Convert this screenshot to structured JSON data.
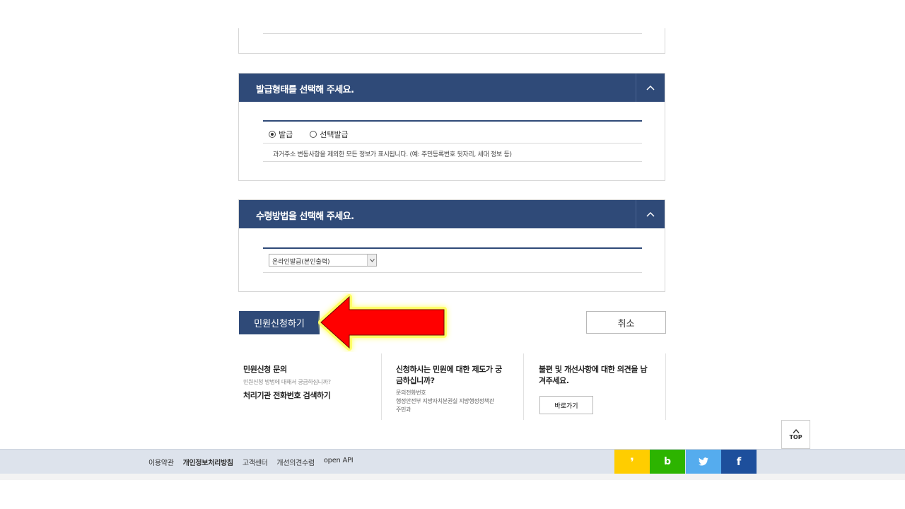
{
  "issue_form": {
    "title": "발급형태를 선택해 주세요.",
    "options": [
      {
        "label": "발급",
        "selected": true
      },
      {
        "label": "선택발급",
        "selected": false
      }
    ],
    "note": "과거주소 변동사항을 제외한 모든 정보가 표시됩니다. (예: 주민등록번호 뒷자리, 세대 정보 등)"
  },
  "receive_method": {
    "title": "수령방법을 선택해 주세요.",
    "selected": "온라인발급(본인출력)"
  },
  "actions": {
    "submit_label": "민원신청하기",
    "cancel_label": "취소"
  },
  "annotation": {
    "arrow_color": "#ff0000",
    "glow_color": "#ffff66"
  },
  "info": {
    "col1": {
      "title": "민원신청 문의",
      "sub": "민원신청 방법에 대해서 궁금하십니까?",
      "link": "처리기관 전화번호 검색하기"
    },
    "col2": {
      "title_line1": "신청하시는 민원에 대한 제도가 궁",
      "title_line2": "금하십니까?",
      "label": "문의전화번호",
      "dept_line1": "행정안전부 지방자치분권실 지방행정정책관",
      "dept_line2": "주민과"
    },
    "col3": {
      "title_line1": "불편 및 개선사항에 대한 의견을 남",
      "title_line2": "겨주세요.",
      "button": "바로가기"
    }
  },
  "top_button": {
    "label": "TOP"
  },
  "footer": {
    "links": [
      {
        "label": "이용약관",
        "bold": false
      },
      {
        "label": "개인정보처리방침",
        "bold": true
      },
      {
        "label": "고객센터",
        "bold": false
      },
      {
        "label": "개선의견수렴",
        "bold": false
      },
      {
        "label": "open API",
        "bold": false
      }
    ],
    "social": [
      {
        "icon": "kakaostory-icon",
        "glyph": "❜",
        "color": "#ffcd00"
      },
      {
        "icon": "band-icon",
        "glyph": "b",
        "color": "#2db400"
      },
      {
        "icon": "twitter-icon",
        "glyph": "🐦",
        "color": "#55acee"
      },
      {
        "icon": "facebook-icon",
        "glyph": "f",
        "color": "#1d4f9c"
      }
    ]
  },
  "colors": {
    "header_navy": "#2f4a78"
  }
}
